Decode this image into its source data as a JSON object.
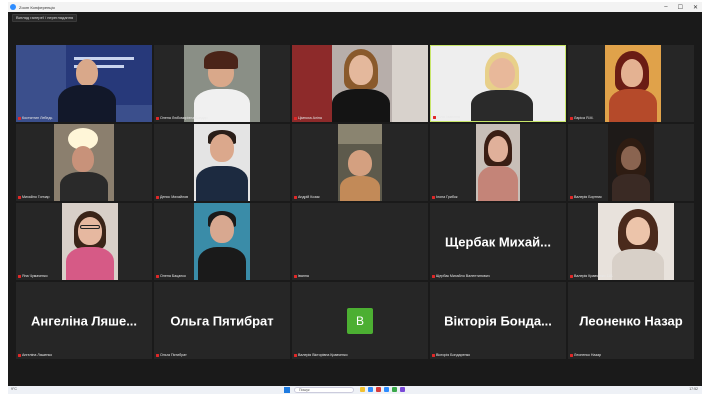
{
  "window": {
    "title": "Zoom Конференція"
  },
  "toolbar": {
    "view_label": "Вигляд галереї / переглядання"
  },
  "participants": [
    {
      "label": "Костянтин Лебедь"
    },
    {
      "label": "Олена Любомирівна Бондар"
    },
    {
      "label": "Цімпоха Аліна"
    },
    {
      "label": "Юлія Іванівна"
    },
    {
      "label": "Ларіса Я.М."
    },
    {
      "label": "Михайло Гончар"
    },
    {
      "label": "Денис Михайлов"
    },
    {
      "label": "Андрій Козак"
    },
    {
      "label": "Ілона Грибок"
    },
    {
      "label": "Валерія Бортник"
    },
    {
      "label": "Яна Чумаченко"
    },
    {
      "label": "Олена Бацанко"
    },
    {
      "label": "Іванна"
    },
    {
      "label": "Щербак Михайло Валентинович",
      "big": "Щербак Михай..."
    },
    {
      "label": "Валерія Кравченко 11Б"
    },
    {
      "label": "Ангеліна Ляшенко",
      "big": "Ангеліна Ляше..."
    },
    {
      "label": "Ольга Пятибрат",
      "big": "Ольга Пятибрат"
    },
    {
      "label": "Валерія Вікторівна Кравченко",
      "avatar": "В"
    },
    {
      "label": "Вікторія Бондаренко",
      "big": "Вікторія Бонда..."
    },
    {
      "label": "Леоненко Назар",
      "big": "Леоненко Назар"
    }
  ],
  "taskbar": {
    "weather": "9°C",
    "search_placeholder": "Пошук",
    "time": "17:52"
  },
  "colors": {
    "zoom_bg": "#1a1a1a",
    "tile_bg": "#262626",
    "avatar_green": "#4caf32",
    "mic_muted": "#e02828"
  }
}
